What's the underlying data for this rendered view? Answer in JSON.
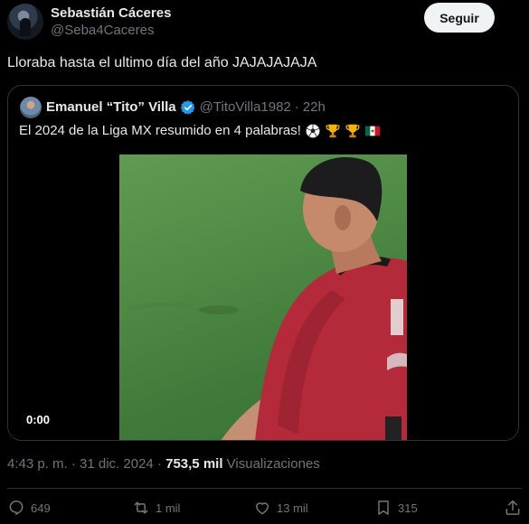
{
  "author": {
    "display_name": "Sebastián Cáceres",
    "handle": "@Seba4Caceres",
    "follow_label": "Seguir"
  },
  "tweet_text": "Lloraba hasta el ultimo día del año JAJAJAJAJA",
  "quoted": {
    "display_name": "Emanuel “Tito” Villa",
    "handle": "@TitoVilla1982",
    "separator": "·",
    "time": "22h",
    "text": "El 2024 de la Liga MX resumido en 4 palabras!",
    "emojis": [
      "soccer-ball-icon",
      "trophy-icon",
      "trophy-icon",
      "mexico-flag-icon"
    ],
    "video_time": "0:00"
  },
  "meta": {
    "time_date": "4:43 p. m. · 31 dic. 2024 ·",
    "views_count": "753,5 mil",
    "views_label": "Visualizaciones"
  },
  "actions": {
    "replies": "649",
    "reposts": "1 mil",
    "likes": "13 mil",
    "bookmarks": "315"
  },
  "colors": {
    "background": "#000000",
    "text": "#e7e9ea",
    "muted": "#71767b",
    "border": "#2f3336",
    "verified": "#1d9bf0",
    "follow_bg": "#eff3f4"
  }
}
